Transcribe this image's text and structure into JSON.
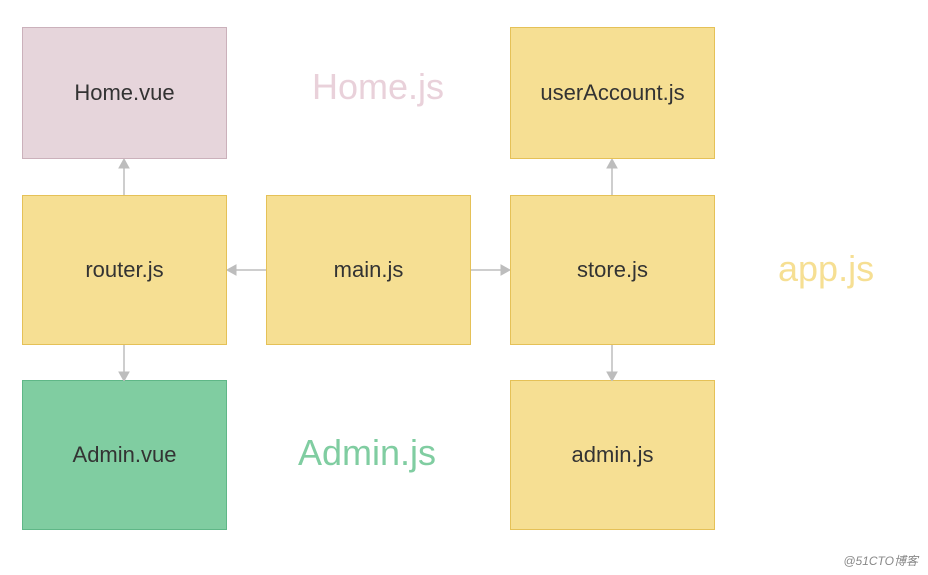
{
  "nodes": {
    "home_vue": "Home.vue",
    "user_account_js": "userAccount.js",
    "router_js": "router.js",
    "main_js": "main.js",
    "store_js": "store.js",
    "admin_vue": "Admin.vue",
    "admin_js": "admin.js"
  },
  "labels": {
    "home_js": "Home.js",
    "admin_js": "Admin.js",
    "app_js": "app.js"
  },
  "colors": {
    "yellow": "#f6df93",
    "pink": "#e6d5db",
    "green": "#80cda1"
  },
  "edges": [
    {
      "from": "router.js",
      "to": "Home.vue"
    },
    {
      "from": "router.js",
      "to": "Admin.vue"
    },
    {
      "from": "main.js",
      "to": "router.js"
    },
    {
      "from": "main.js",
      "to": "store.js"
    },
    {
      "from": "store.js",
      "to": "userAccount.js"
    },
    {
      "from": "store.js",
      "to": "admin.js"
    }
  ],
  "watermark": "@51CTO博客"
}
